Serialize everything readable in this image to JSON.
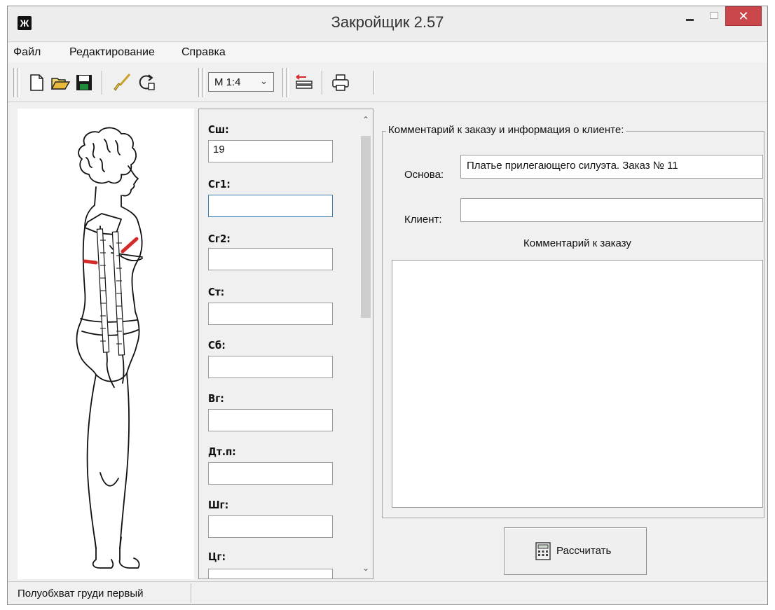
{
  "window": {
    "title": "Закройщик 2.57",
    "close_glyph": "✕"
  },
  "menu": [
    "Файл",
    "Редактирование",
    "Справка"
  ],
  "toolbar": {
    "icons": [
      "new-file-icon",
      "open-folder-icon",
      "save-icon",
      "clear-brush-icon",
      "refresh-icon",
      "scale-icon",
      "print-icon"
    ],
    "zoom": "М 1:4",
    "zoom_arrow": "⌄"
  },
  "measurements": [
    {
      "label": "Сш:",
      "value": "19"
    },
    {
      "label": "Сг1:",
      "value": ""
    },
    {
      "label": "Сг2:",
      "value": ""
    },
    {
      "label": "Ст:",
      "value": ""
    },
    {
      "label": "Сб:",
      "value": ""
    },
    {
      "label": "Вг:",
      "value": ""
    },
    {
      "label": "Дт.п:",
      "value": ""
    },
    {
      "label": "Шг:",
      "value": ""
    },
    {
      "label": "Цг:",
      "value": ""
    }
  ],
  "info": {
    "group_title": "Комментарий к заказу и информация о клиенте:",
    "base_label": "Основа:",
    "base_value": "Платье прилегающего силуэта. Заказ № 11",
    "client_label": "Клиент:",
    "client_value": "",
    "comment_caption": "Комментарий к заказу",
    "comment_value": ""
  },
  "calculate_label": "Рассчитать",
  "status": "Полуобхват груди первый",
  "colors": {
    "close_button": "#c9464a",
    "measure_mark": "#d42a2a",
    "focus_border": "#3c7fb1"
  }
}
